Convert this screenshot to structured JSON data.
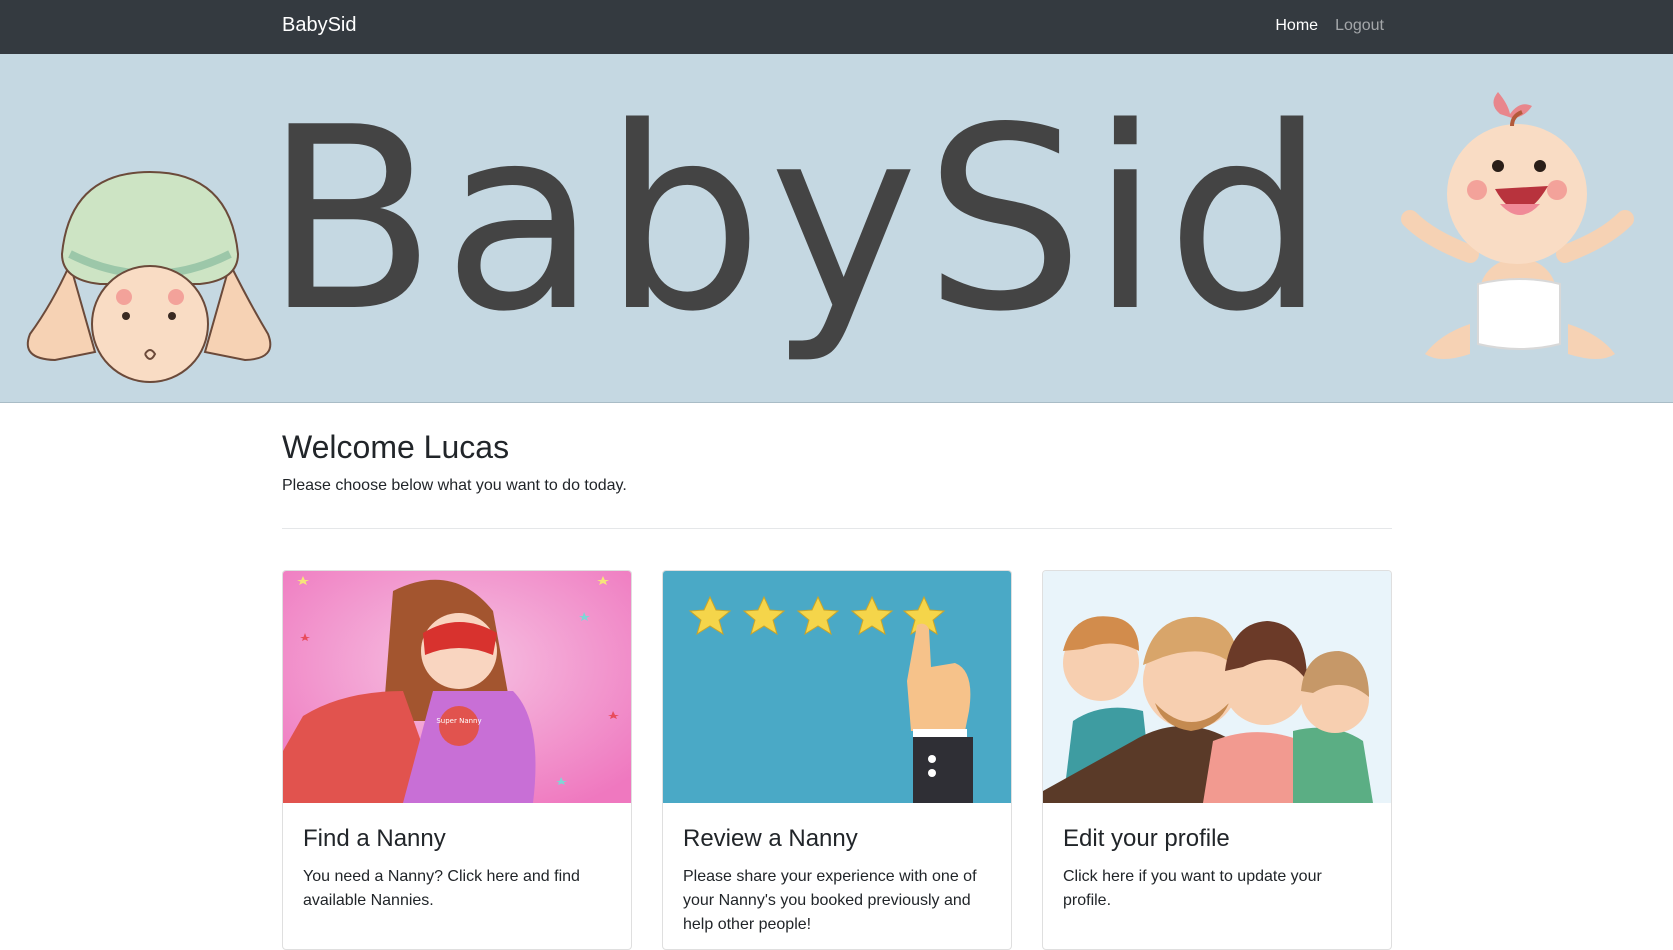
{
  "nav": {
    "brand": "BabySid",
    "links": [
      {
        "label": "Home"
      },
      {
        "label": "Logout"
      }
    ]
  },
  "hero": {
    "title": "BabySid"
  },
  "main": {
    "welcome": "Welcome Lucas",
    "subtitle": "Please choose below what you want to do today."
  },
  "cards": [
    {
      "title": "Find a Nanny",
      "text": "You need a Nanny? Click here and find available Nannies.",
      "badge": "Super Nanny"
    },
    {
      "title": "Review a Nanny",
      "text": "Please share your experience with one of your Nanny's you booked previously and help other people!"
    },
    {
      "title": "Edit your profile",
      "text": "Click here if you want to update your profile."
    }
  ],
  "colors": {
    "navbar": "#343a40",
    "hero_bg": "#c5d8e2",
    "hero_title": "#444444",
    "card1_bg": "#f07fc2",
    "card2_bg": "#4aa9c6",
    "card3_bg": "#e9f4fa"
  }
}
